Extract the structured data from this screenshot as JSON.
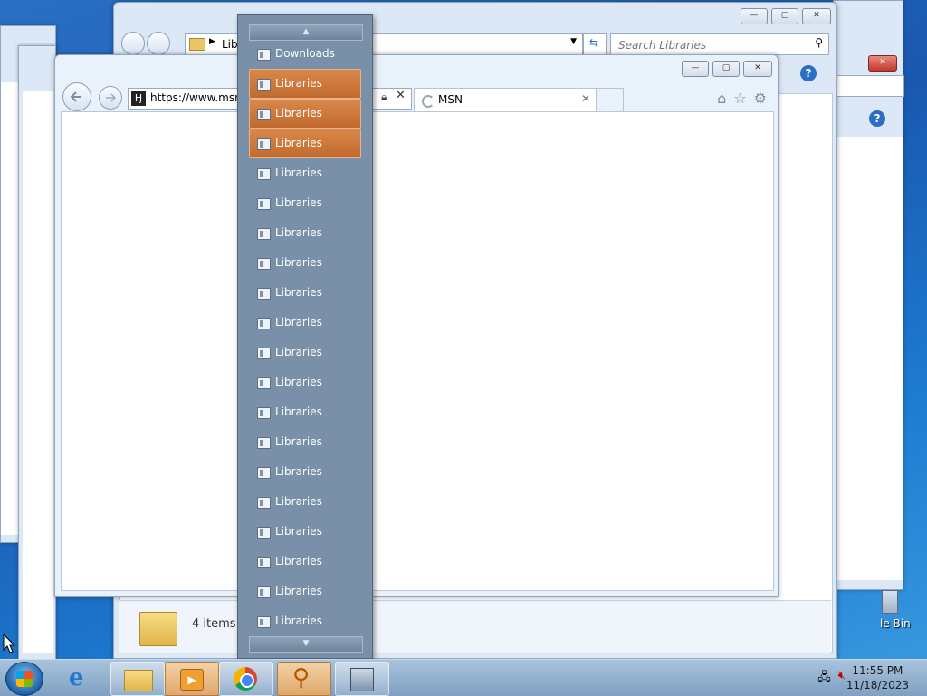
{
  "explorer": {
    "address_segment": "Libr",
    "search_placeholder": "Search Libraries",
    "status_count": "4 items"
  },
  "browser": {
    "url": "https://www.msn.c",
    "tab_title": "MSN"
  },
  "jumplist": {
    "items": [
      {
        "label": "Downloads",
        "highlighted": false
      },
      {
        "label": "Libraries",
        "highlighted": true
      },
      {
        "label": "Libraries",
        "highlighted": true
      },
      {
        "label": "Libraries",
        "highlighted": true
      },
      {
        "label": "Libraries",
        "highlighted": false
      },
      {
        "label": "Libraries",
        "highlighted": false
      },
      {
        "label": "Libraries",
        "highlighted": false
      },
      {
        "label": "Libraries",
        "highlighted": false
      },
      {
        "label": "Libraries",
        "highlighted": false
      },
      {
        "label": "Libraries",
        "highlighted": false
      },
      {
        "label": "Libraries",
        "highlighted": false
      },
      {
        "label": "Libraries",
        "highlighted": false
      },
      {
        "label": "Libraries",
        "highlighted": false
      },
      {
        "label": "Libraries",
        "highlighted": false
      },
      {
        "label": "Libraries",
        "highlighted": false
      },
      {
        "label": "Libraries",
        "highlighted": false
      },
      {
        "label": "Libraries",
        "highlighted": false
      },
      {
        "label": "Libraries",
        "highlighted": false
      },
      {
        "label": "Libraries",
        "highlighted": false
      },
      {
        "label": "Libraries",
        "highlighted": false
      }
    ]
  },
  "taskbar": {
    "items": [
      "start-orb",
      "internet-explorer-icon",
      "file-explorer-icon",
      "media-player-icon",
      "chrome-icon",
      "search-magnifier-icon",
      "network-tool-icon"
    ],
    "clock_time": "11:55 PM",
    "clock_date": "11/18/2023"
  },
  "desktop": {
    "recycle_label": "le Bin"
  },
  "colors": {
    "highlight": "#c9753a",
    "jumplist_bg": "#7990a8"
  }
}
